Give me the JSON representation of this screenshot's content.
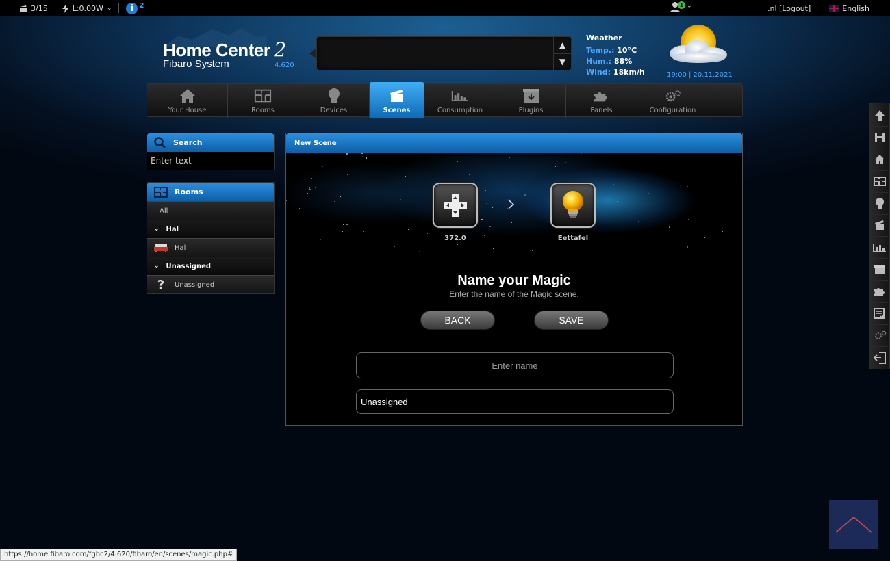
{
  "topbar": {
    "scenes_count": "3/15",
    "power": "L:0.00W",
    "info_count": "2",
    "user_badge": "1",
    "account": ".nl [Logout]",
    "language": "English"
  },
  "header": {
    "logo_main": "Home Center",
    "logo_number": "2",
    "logo_sub": "Fibaro System",
    "version": "4.620"
  },
  "weather": {
    "title": "Weather",
    "temp_label": "Temp.:",
    "temp_value": "10°C",
    "hum_label": "Hum.:",
    "hum_value": "88%",
    "wind_label": "Wind:",
    "wind_value": "18km/h",
    "datetime": "19:00 | 20.11.2021"
  },
  "nav": {
    "items": [
      {
        "label": "Your House",
        "icon": "house-icon"
      },
      {
        "label": "Rooms",
        "icon": "rooms-icon"
      },
      {
        "label": "Devices",
        "icon": "bulb-icon"
      },
      {
        "label": "Scenes",
        "icon": "clapper-icon"
      },
      {
        "label": "Consumption",
        "icon": "chart-icon"
      },
      {
        "label": "Plugins",
        "icon": "box-icon"
      },
      {
        "label": "Panels",
        "icon": "puzzle-icon"
      },
      {
        "label": "Configuration",
        "icon": "gears-icon"
      }
    ],
    "active": "Scenes"
  },
  "search": {
    "title": "Search",
    "placeholder": "Enter text"
  },
  "rooms": {
    "title": "Rooms",
    "all": "All",
    "groups": [
      {
        "name": "Hal",
        "rooms": [
          "Hal"
        ]
      },
      {
        "name": "Unassigned",
        "rooms": [
          "Unassigned"
        ]
      }
    ]
  },
  "scene": {
    "title": "New Scene",
    "trigger_label": "372.0",
    "target_label": "Eettafel",
    "heading": "Name your Magic",
    "subheading": "Enter the name of the Magic scene.",
    "back_label": "BACK",
    "save_label": "SAVE",
    "name_placeholder": "Enter name",
    "room_value": "Unassigned"
  },
  "status_url": "https://home.fibaro.com/fghc2/4.620/fibaro/en/scenes/magic.php#",
  "colors": {
    "accent_blue": "#1a7de0",
    "header_blue": "#2c8fe0",
    "background": "#041021"
  }
}
